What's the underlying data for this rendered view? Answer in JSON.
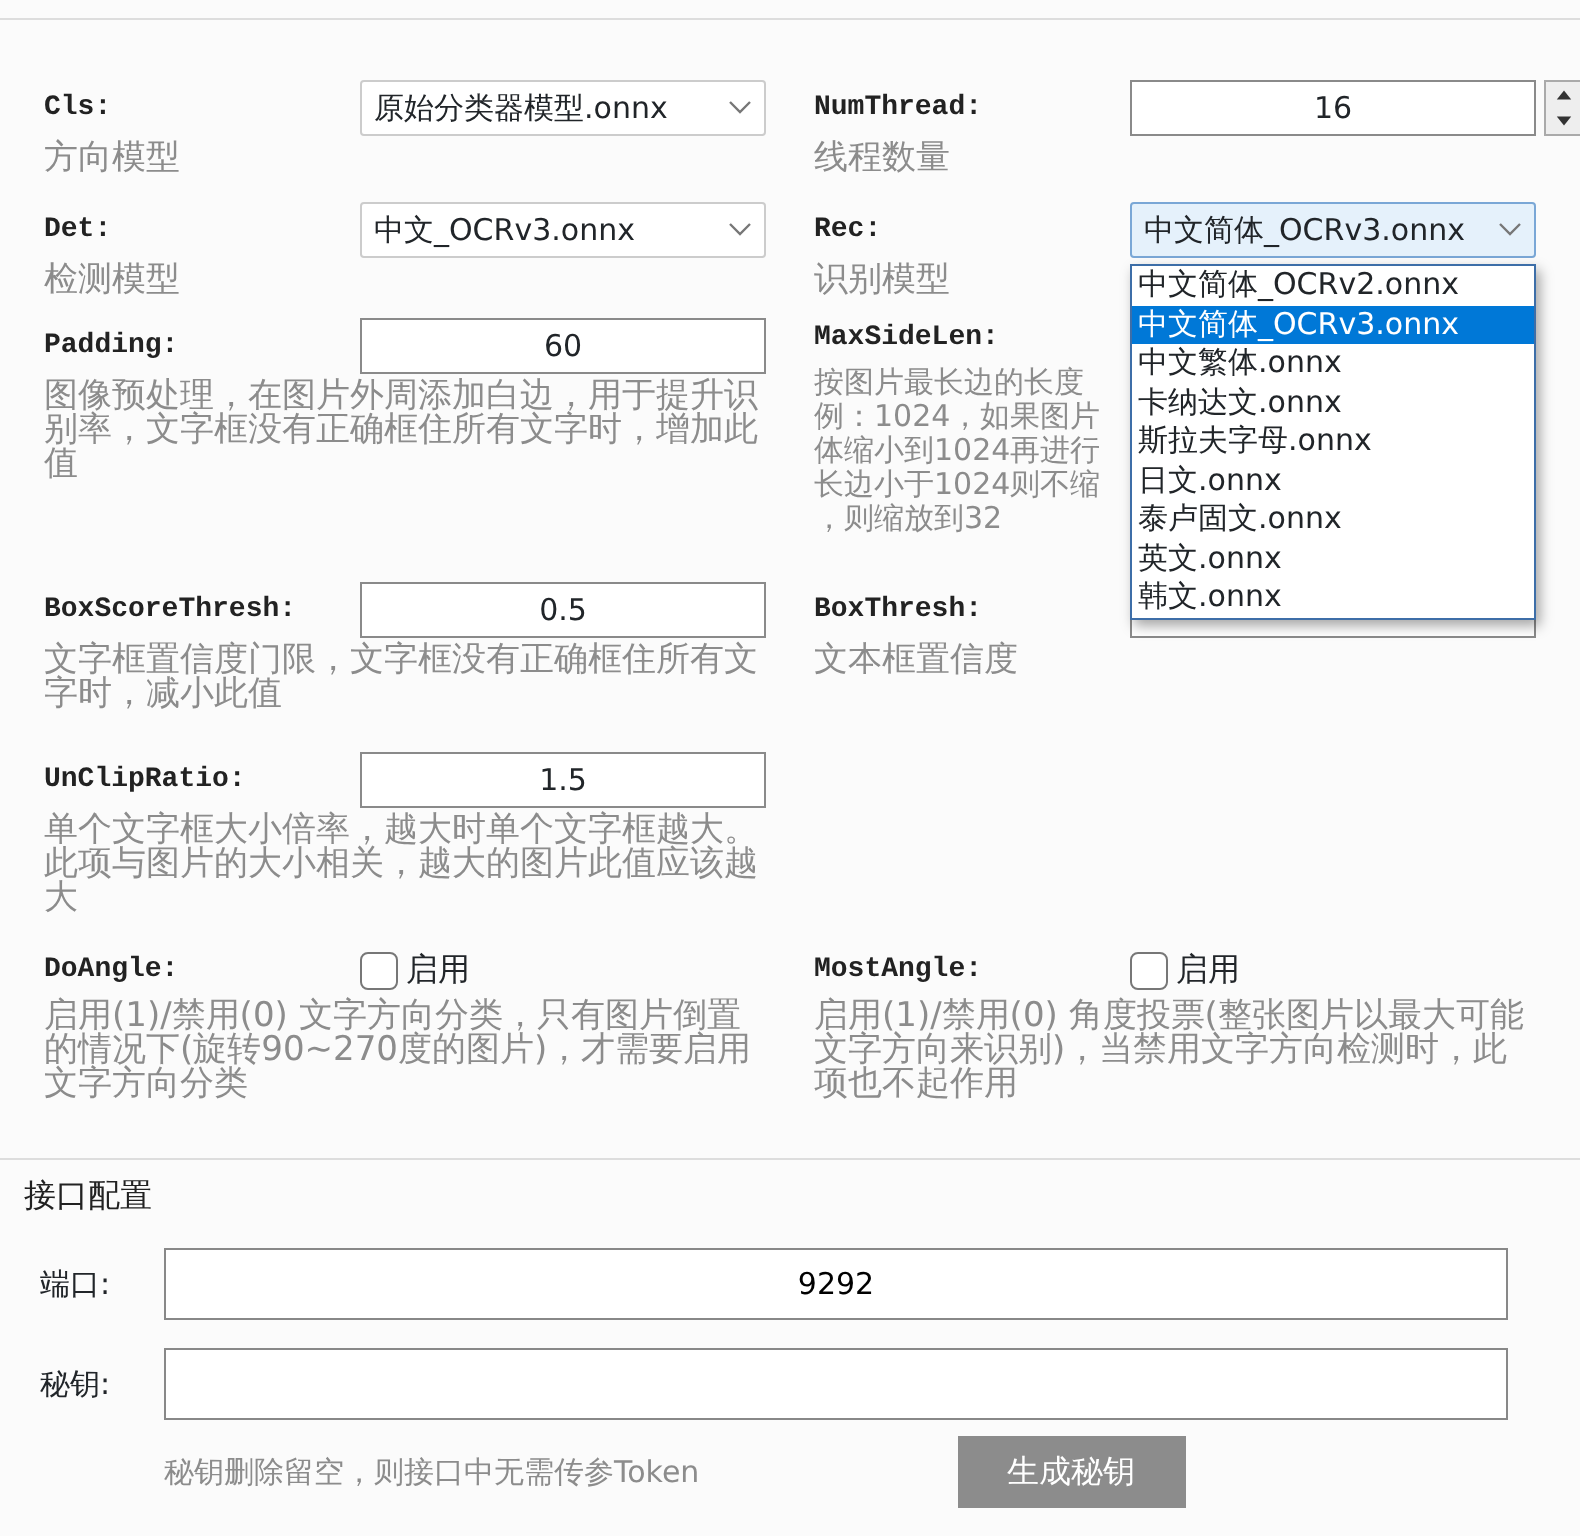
{
  "rows": [
    {
      "left": {
        "label": "Cls:",
        "kind": "select",
        "value": "原始分类器模型.onnx",
        "description": "方向模型"
      },
      "right": {
        "label": "NumThread:",
        "kind": "spin",
        "value": "16",
        "description": "线程数量"
      }
    },
    {
      "left": {
        "label": "Det:",
        "kind": "select",
        "value": "中文_OCRv3.onnx",
        "description": "检测模型"
      },
      "right": {
        "label": "Rec:",
        "kind": "select",
        "value": "中文简体_OCRv3.onnx",
        "description": "识别模型",
        "open": true,
        "options": [
          {
            "label": "中文简体_OCRv2.onnx",
            "selected": false
          },
          {
            "label": "中文简体_OCRv3.onnx",
            "selected": true
          },
          {
            "label": "中文繁体.onnx",
            "selected": false
          },
          {
            "label": "卡纳达文.onnx",
            "selected": false
          },
          {
            "label": "斯拉夫字母.onnx",
            "selected": false
          },
          {
            "label": "日文.onnx",
            "selected": false
          },
          {
            "label": "泰卢固文.onnx",
            "selected": false
          },
          {
            "label": "英文.onnx",
            "selected": false
          },
          {
            "label": "韩文.onnx",
            "selected": false
          }
        ]
      }
    },
    {
      "left": {
        "label": "Padding:",
        "kind": "text",
        "value": "60",
        "description": "图像预处理，在图片外周添加白边，用于提升识别率，文字框没有正确框住所有文字时，增加此值"
      },
      "right": {
        "label": "MaxSideLen:",
        "kind": "none",
        "description_lines": [
          "按图片最长边的长度",
          "例：1024，如果图片",
          "体缩小到1024再进行",
          "长边小于1024则不缩",
          "，则缩放到32"
        ]
      }
    },
    {
      "left": {
        "label": "BoxScoreThresh:",
        "kind": "text",
        "value": "0.5",
        "description": "文字框置信度门限，文字框没有正确框住所有文字时，减小此值"
      },
      "right": {
        "label": "BoxThresh:",
        "kind": "text",
        "description": "文本框置信度"
      }
    },
    {
      "left": {
        "label": "UnClipRatio:",
        "kind": "text",
        "value": "1.5",
        "description": "单个文字框大小倍率，越大时单个文字框越大。此项与图片的大小相关，越大的图片此值应该越大"
      }
    },
    {
      "left": {
        "label": "DoAngle:",
        "kind": "checkbox",
        "text": "启用",
        "checked": false,
        "description": "启用(1)/禁用(0) 文字方向分类，只有图片倒置的情况下(旋转90~270度的图片)，才需要启用文字方向分类"
      },
      "right": {
        "label": "MostAngle:",
        "kind": "checkbox",
        "text": "启用",
        "checked": false,
        "description": "启用(1)/禁用(0) 角度投票(整张图片以最大可能文字方向来识别)，当禁用文字方向检测时，此项也不起作用"
      }
    }
  ],
  "api": {
    "title": "接口配置",
    "fields": [
      {
        "label": "端口:",
        "value": "9292"
      },
      {
        "label": "秘钥:"
      }
    ],
    "hint": "秘钥删除留空，则接口中无需传参Token",
    "buttons": [
      "生成秘钥"
    ]
  }
}
